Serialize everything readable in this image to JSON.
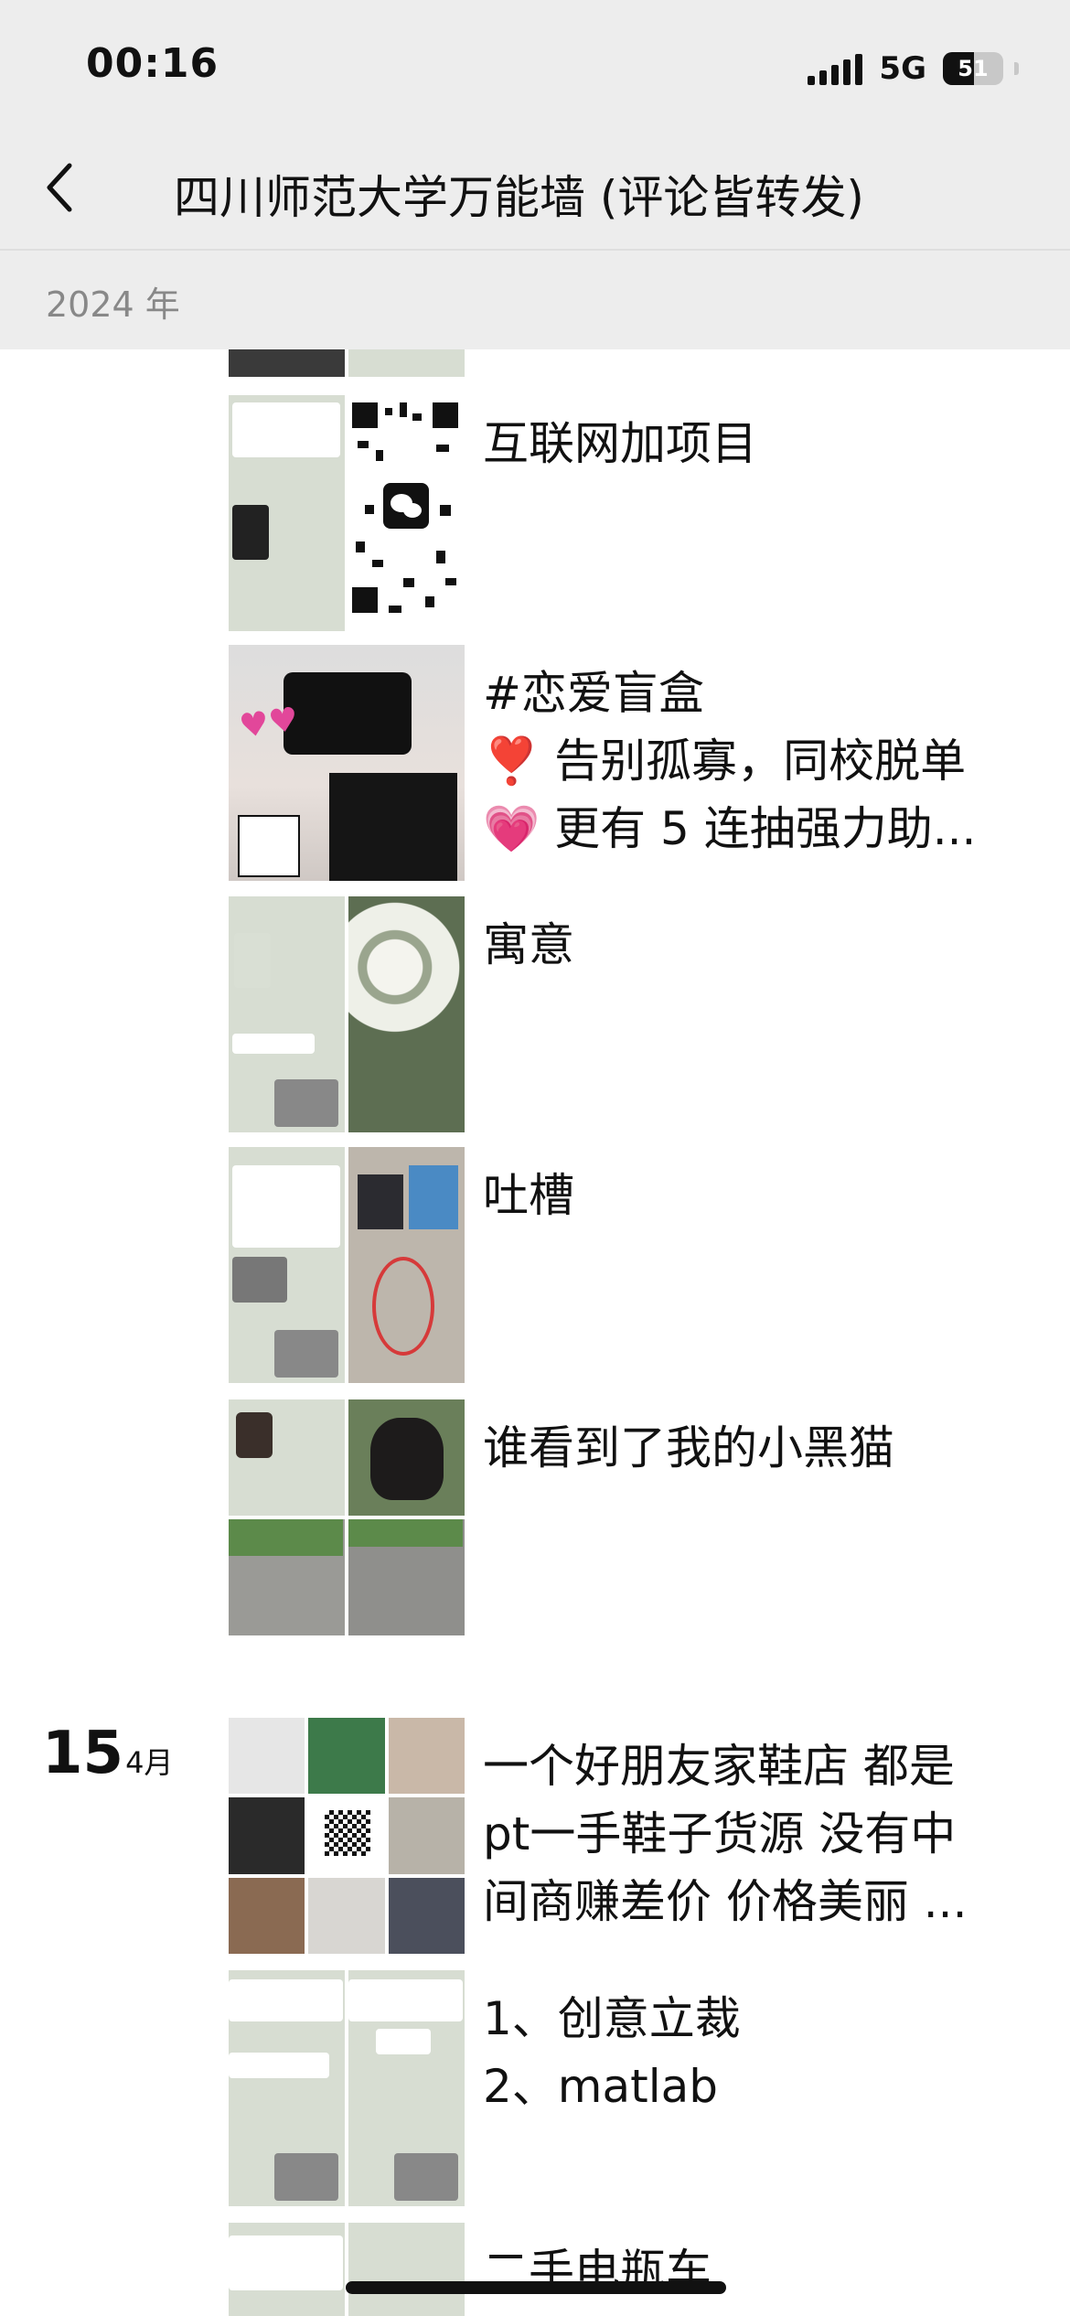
{
  "status": {
    "time": "00:16",
    "network": "5G",
    "battery": "51",
    "battery_level": 0.51
  },
  "nav": {
    "title": "四川师范大学万能墙 (评论皆转发)"
  },
  "year": "2024 年",
  "posts_top": [
    {
      "text": "互联网加项目",
      "image_count": 2
    },
    {
      "text": "#恋爱盲盒\n❣️ 告别孤寡，同校脱单\n💗 更有 5 连抽强力助...",
      "image_count": 1
    },
    {
      "text": "寓意",
      "image_count": 2
    },
    {
      "text": "吐槽",
      "image_count": 2
    },
    {
      "text": "谁看到了我的小黑猫",
      "image_count": 4
    }
  ],
  "date_group": {
    "day": "15",
    "month": "4月"
  },
  "posts_bottom": [
    {
      "text": "一个好朋友家鞋店 都是\npt一手鞋子货源 没有中\n间商赚差价 价格美丽 ...",
      "image_count": 9
    },
    {
      "text": "1、创意立裁\n2、matlab",
      "image_count": 2
    },
    {
      "text": "二手电瓶车",
      "image_count": 2
    }
  ],
  "colors": {
    "topbar": "#ededed",
    "text": "#111111",
    "muted": "#888888"
  }
}
